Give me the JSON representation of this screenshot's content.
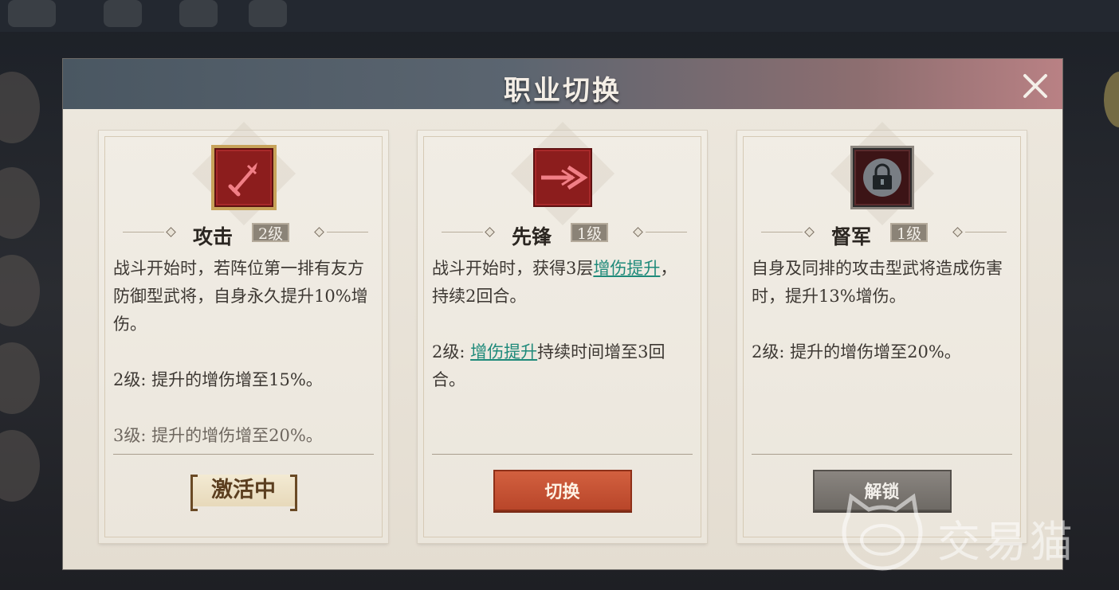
{
  "dialog": {
    "title": "职业切换"
  },
  "cards": [
    {
      "name": "攻击",
      "level": "2级",
      "icon": "sword-icon",
      "desc_line1": "战斗开始时，若阵位第一排有友方防御型武将，自身永久提升10%增伤。",
      "lv2_text": "2级: 提升的增伤增至15%。",
      "lv3_text": "3级: 提升的增伤增至20%。",
      "status_label": "激活中"
    },
    {
      "name": "先锋",
      "level": "1级",
      "icon": "spear-charge-icon",
      "desc_pre": "战斗开始时，获得3层",
      "desc_link": "增伤提升",
      "desc_post": "，持续2回合。",
      "lv2_prefix": "2级: ",
      "lv2_link": "增伤提升",
      "lv2_post": "持续时间增至3回合。",
      "button_label": "切换"
    },
    {
      "name": "督军",
      "level": "1级",
      "icon": "lock-icon",
      "desc_line1": "自身及同排的攻击型武将造成伤害时，提升13%增伤。",
      "lv2_text": "2级: 提升的增伤增至20%。",
      "button_label": "解锁"
    }
  ],
  "watermark": {
    "text": "交易猫"
  },
  "colors": {
    "accent_red": "#b9462a",
    "link_teal": "#1f8a7a",
    "icon_red": "#8c1d1d"
  }
}
